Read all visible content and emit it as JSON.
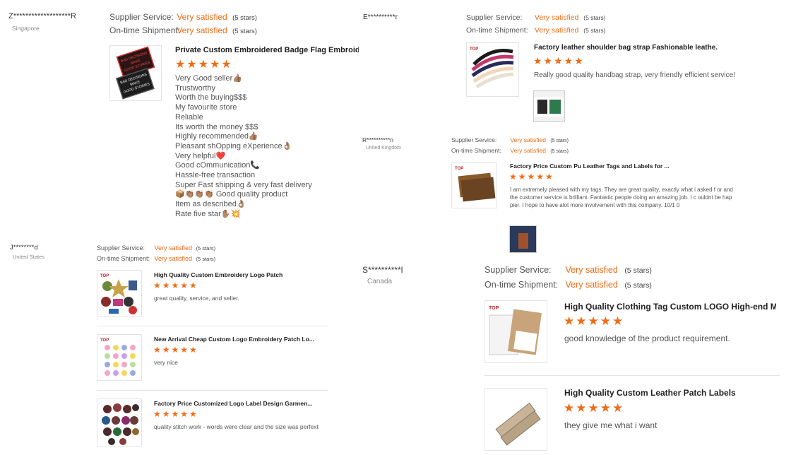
{
  "ratings_text": "(5 stars)",
  "satisfied": "Very satisfied",
  "supplier_label": "Supplier Service:",
  "shipment_label": "On-time Shipment:",
  "star_glyphs": "★★★★★",
  "reviews": [
    {
      "name": "Z*******************R",
      "country": "Singapore",
      "product_title": "Private Custom Embroidered Badge Flag Embroidery ...",
      "lines": [
        "Very Good seller👍🏽",
        "Trustworthy",
        "Worth the buying$$$",
        "My favourite store",
        "Reliable",
        "Its worth the money $$$",
        "Highly recommended👍🏽",
        "Pleasant shOpping eXperience👌🏽",
        "Very helpful❤️",
        "Good cOmmunication📞",
        "Hassle-free transaction",
        "Super Fast shipping & very fast delivery",
        "📦👏🏽👏🏽👏🏽 Good quality product",
        "Item as described👌🏽",
        "Rate five star✋🏽💥"
      ]
    },
    {
      "name": "J********d",
      "country": "United States",
      "products": [
        {
          "title": "High Quality Custom Embroidery Logo Patch",
          "comment": "great quality, service, and seller."
        },
        {
          "title": "New Arrival Cheap Custom Logo Embroidery Patch Lo...",
          "comment": "very nice"
        },
        {
          "title": "Factory Price Customized Logo Label Design Garmen...",
          "comment": "quality stitch work - words were clear and the size was perfext"
        }
      ]
    },
    {
      "name": "E**********r",
      "country": "",
      "product_title": "Factory leather shoulder bag strap Fashionable leathe...",
      "comment": "Really good quality handbag strap, very friendly efficient service!"
    },
    {
      "name": "R**********n",
      "country": "United Kingdom",
      "product_title": "Factory Price Custom Pu Leather Tags and Labels for ...",
      "comment": "I am extremely pleased with my tags. They are great quality, exactly what i asked f or and the customer service is brilliant. Fantastic people doing an amazing job. I c ouldnt be happier. I hope to have alot more involvement with this company. 10/1 0"
    },
    {
      "name": "S**********l",
      "country": "Canada",
      "products": [
        {
          "title": "High Quality Clothing Tag Custom LOGO High-end Me...",
          "comment": "good knowledge of the product requirement."
        },
        {
          "title": "High Quality Custom Leather Patch Labels",
          "comment": "they give me what i want"
        }
      ]
    }
  ],
  "logo_text": "TOP",
  "badge_text": "BAD DECISIONS MAKE GOOD STORIES"
}
